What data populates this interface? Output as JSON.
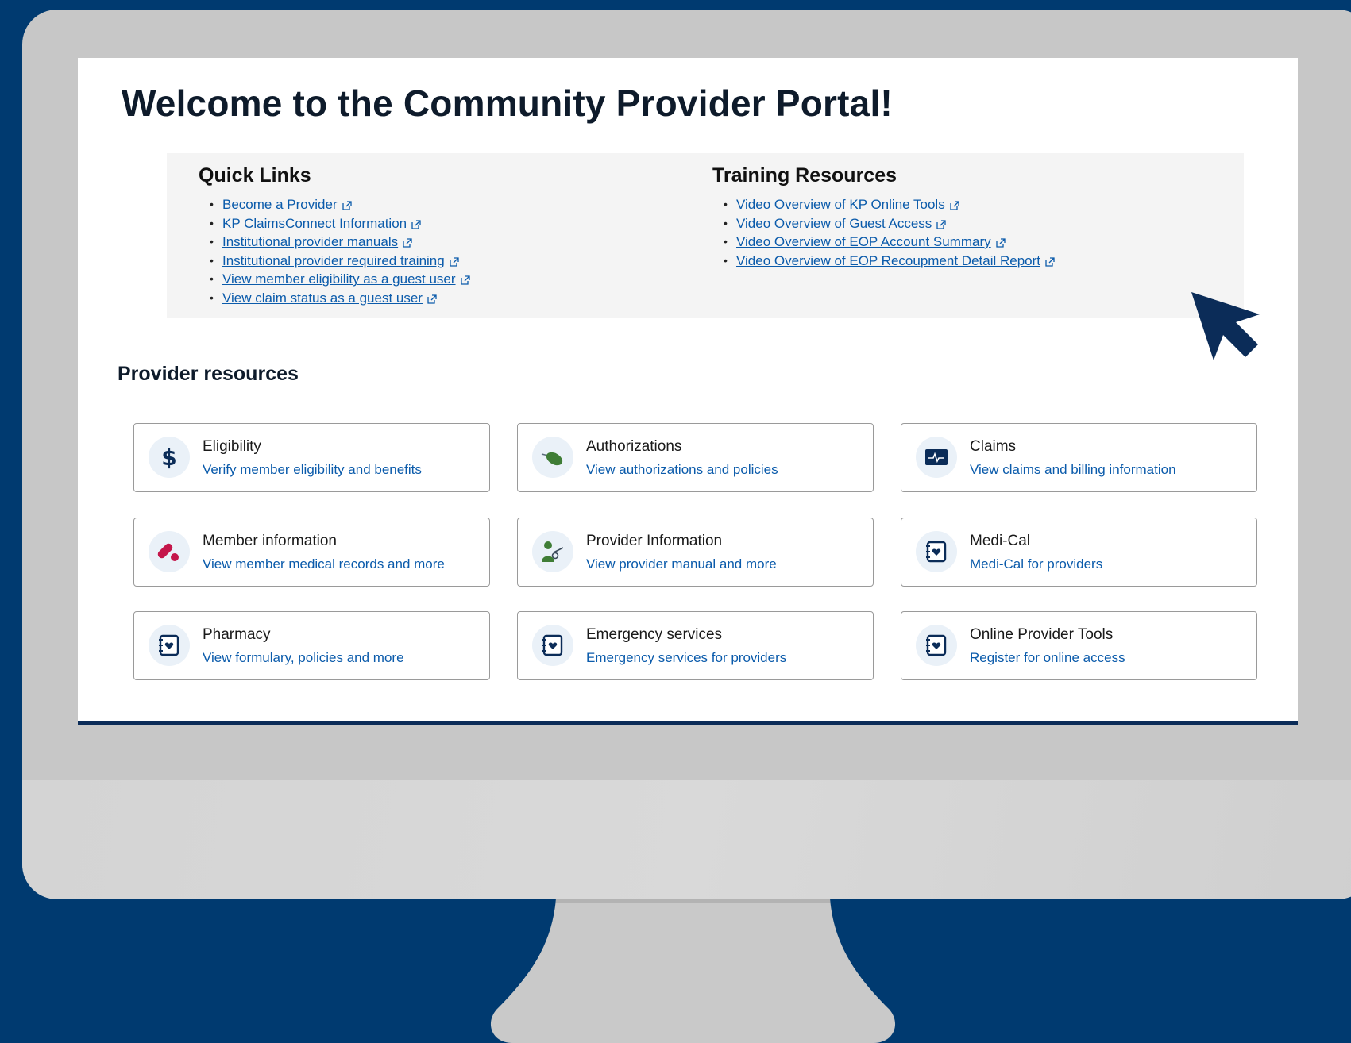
{
  "page": {
    "title": "Welcome to the Community Provider Portal!"
  },
  "quick_links": {
    "heading": "Quick Links",
    "items": [
      "Become a Provider",
      "KP ClaimsConnect Information",
      "Institutional provider manuals",
      "Institutional provider required training",
      "View member eligibility as a guest user",
      "View claim status as a guest user"
    ]
  },
  "training": {
    "heading": "Training Resources",
    "items": [
      "Video Overview of KP Online Tools",
      "Video Overview of Guest Access",
      "Video Overview of EOP Account Summary",
      "Video Overview of EOP Recoupment Detail Report"
    ]
  },
  "provider_resources": {
    "heading": "Provider resources",
    "cards": [
      {
        "title": "Eligibility",
        "desc": "Verify member eligibility and benefits",
        "icon": "dollar-icon"
      },
      {
        "title": "Authorizations",
        "desc": "View authorizations and policies",
        "icon": "pill-icon"
      },
      {
        "title": "Claims",
        "desc": "View claims and billing information",
        "icon": "monitor-pulse-icon"
      },
      {
        "title": "Member information",
        "desc": "View member medical records and more",
        "icon": "pills-icon"
      },
      {
        "title": "Provider Information",
        "desc": "View provider manual and more",
        "icon": "doctor-icon"
      },
      {
        "title": "Medi-Cal",
        "desc": "Medi-Cal for providers",
        "icon": "heart-notebook-icon"
      },
      {
        "title": "Pharmacy",
        "desc": "View formulary, policies and more",
        "icon": "heart-notebook-icon"
      },
      {
        "title": "Emergency services",
        "desc": "Emergency services for providers",
        "icon": "heart-notebook-icon"
      },
      {
        "title": "Online Provider Tools",
        "desc": "Register for online access",
        "icon": "heart-notebook-icon"
      }
    ]
  },
  "colors": {
    "background": "#003a70",
    "link": "#0b5bab",
    "heading": "#0e1b2b",
    "bezel": "#c7c7c7",
    "cursor": "#0b2c58"
  }
}
